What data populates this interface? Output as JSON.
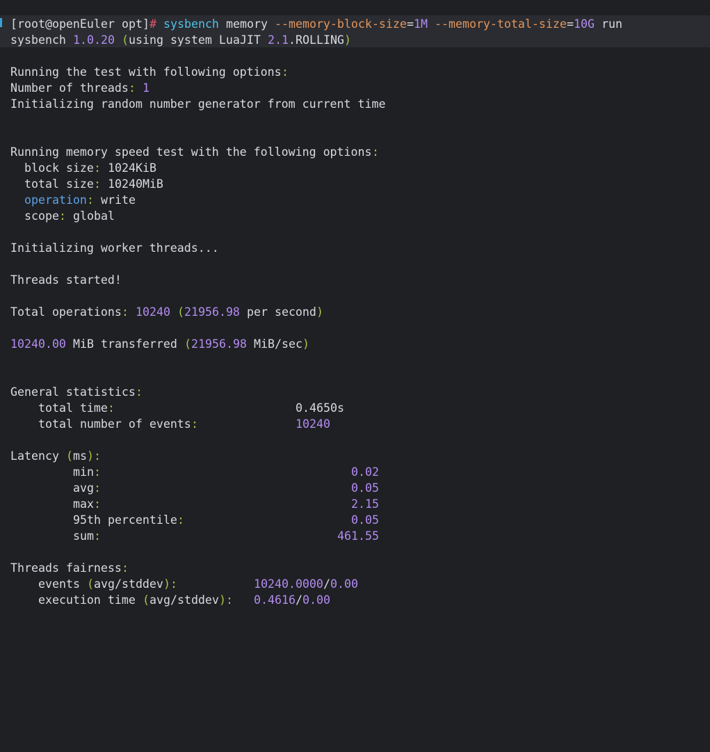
{
  "prompt": {
    "open": "[",
    "user_host": "root@openEuler",
    "cwd": "opt",
    "close": "]",
    "symbol": "#",
    "command": {
      "program": "sysbench",
      "subcommand": "memory",
      "opt1_name": "--memory-block-size",
      "opt1_eq": "=",
      "opt1_value": "1M",
      "opt2_name": "--memory-total-size",
      "opt2_eq": "=",
      "opt2_value": "10G",
      "action": "run"
    }
  },
  "version": {
    "name": "sysbench",
    "number": "1.0.20",
    "open": "(",
    "text1": "using system LuaJIT",
    "jit_version": "2.1",
    "text2": ".ROLLING",
    "close": ")"
  },
  "options": {
    "header": "Running the test with following options",
    "colon": ":",
    "threads_label": "Number of threads",
    "threads_value": "1",
    "rng": "Initializing random number generator from current time"
  },
  "memory_test": {
    "header": "Running memory speed test with the following options",
    "colon": ":",
    "block_size_label": "block size",
    "block_size_value": "1024KiB",
    "total_size_label": "total size",
    "total_size_value": "10240MiB",
    "operation_label": "operation",
    "operation_value": "write",
    "scope_label": "scope",
    "scope_value": "global"
  },
  "run": {
    "init_workers": "Initializing worker threads...",
    "started": "Threads started!"
  },
  "totals": {
    "ops_label": "Total operations",
    "ops_value": "10240",
    "ops_open": "(",
    "ops_rate": "21956.98",
    "ops_rate_unit": "per second",
    "ops_close": ")",
    "transferred_value": "10240.00",
    "transferred_unit": "MiB transferred",
    "transferred_open": "(",
    "transferred_rate": "21956.98",
    "transferred_rate_unit": "MiB/sec",
    "transferred_close": ")"
  },
  "general": {
    "header": "General statistics",
    "total_time_label": "total time",
    "total_time_value": "0.4650s",
    "events_label": "total number of events",
    "events_value": "10240"
  },
  "latency": {
    "header": "Latency",
    "unit_open": "(",
    "unit": "ms",
    "unit_close": ")",
    "rows": [
      {
        "label": "min",
        "value": "0.02"
      },
      {
        "label": "avg",
        "value": "0.05"
      },
      {
        "label": "max",
        "value": "2.15"
      },
      {
        "label": "95th percentile",
        "value": "0.05"
      },
      {
        "label": "sum",
        "value": "461.55"
      }
    ]
  },
  "fairness": {
    "header": "Threads fairness",
    "events_label": "events",
    "events_open": "(",
    "events_stat": "avg/stddev",
    "events_close": ")",
    "events_avg": "10240.0000",
    "events_slash": "/",
    "events_stddev": "0.00",
    "exec_label": "execution time",
    "exec_open": "(",
    "exec_stat": "avg/stddev",
    "exec_close": ")",
    "exec_avg": "0.4616",
    "exec_slash": "/",
    "exec_stddev": "0.00"
  },
  "colors": {
    "background": "#1f2024",
    "text": "#d9dbe0",
    "punctuation": "#a5c64a",
    "number": "#b38cf0",
    "command": "#4fc1e9",
    "option": "#e4955a",
    "keyword": "#5ea3e8",
    "prompt_symbol": "#e0566a"
  }
}
